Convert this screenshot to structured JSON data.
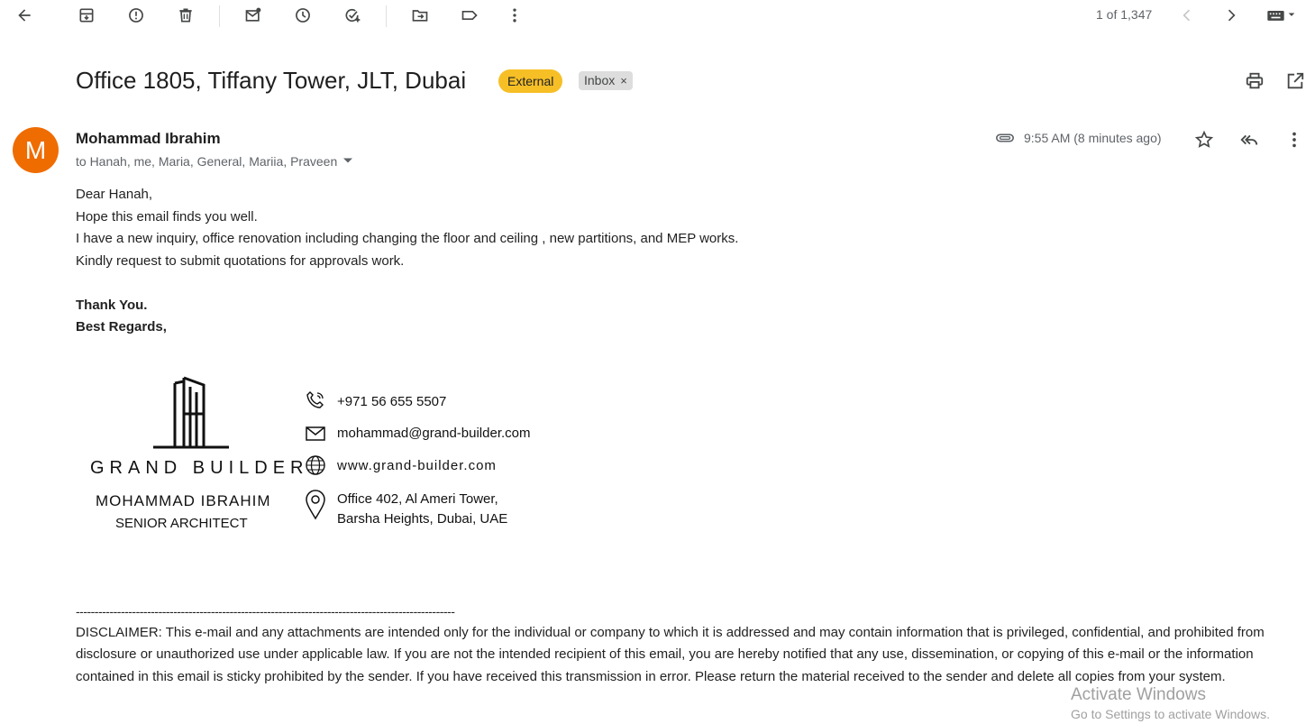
{
  "toolbar": {
    "icons": [
      "back-arrow-icon",
      "archive-icon",
      "report-spam-icon",
      "delete-icon",
      "mark-unread-icon",
      "snooze-icon",
      "add-task-icon",
      "move-to-icon",
      "label-icon",
      "more-vert-icon"
    ],
    "pager_text": "1 of 1,347",
    "prev_icon": "chevron-left-icon",
    "next_icon": "chevron-right-icon",
    "input_tools_icon": "keyboard-icon"
  },
  "email": {
    "subject": "Office 1805, Tiffany Tower, JLT, Dubai",
    "labels": {
      "external": "External",
      "inbox": "Inbox",
      "remove": "×"
    },
    "sender_initial": "M",
    "sender_name": "Mohammad Ibrahim",
    "recipients": "to Hanah, me, Maria, General, Mariia, Praveen",
    "time": "9:55 AM (8 minutes ago)",
    "colors": {
      "avatar": "#ef6c00",
      "external_label": "#f6bf26"
    },
    "body": {
      "greeting": "Dear Hanah,",
      "line1": "Hope this email finds you well.",
      "line2": "I have a new inquiry, office renovation including changing the floor and ceiling , new partitions, and MEP works.",
      "line3": "Kindly request to submit quotations for approvals work.",
      "thanks": "Thank You.",
      "regards": "Best Regards,"
    },
    "signature": {
      "brand": "GRAND BUILDER",
      "name": "MOHAMMAD IBRAHIM",
      "title": "SENIOR ARCHITECT",
      "phone": "+971 56 655 5507",
      "email": "mohammad@grand-builder.com",
      "website": "www.grand-builder.com",
      "address_line1": "Office 402, Al Ameri Tower,",
      "address_line2": "Barsha Heights, Dubai, UAE"
    },
    "divider": "-----------------------------------------------------------------------------------------------------",
    "disclaimer": "DISCLAIMER: This e-mail and any attachments are intended only for the individual or company to which it is addressed and may contain information that is privileged, confidential, and prohibited from disclosure or unauthorized use under applicable law. If you are not the intended recipient of this email, you are hereby notified that any use, dissemination, or copying of this e-mail or the information contained in this email is sticky prohibited by the sender. If you have received this transmission in error. Please return the material received to the sender and delete all copies from your system."
  },
  "watermark": {
    "title": "Activate Windows",
    "subtitle": "Go to Settings to activate Windows."
  }
}
